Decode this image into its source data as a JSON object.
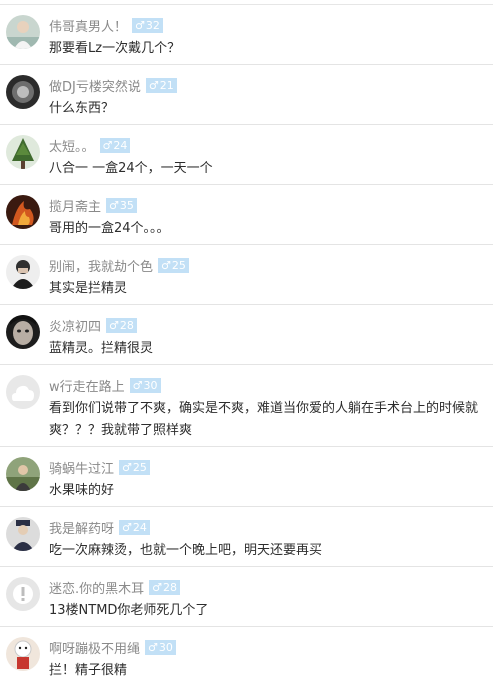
{
  "comments": [
    {
      "username": "伟哥真男人！",
      "gender_symbol": "♂",
      "age": "32",
      "text": "那要看Lz一次戴几个？",
      "avatar_icon": "person-photo-icon"
    },
    {
      "username": "做DJ亏楼突然说",
      "gender_symbol": "♂",
      "age": "21",
      "text": "什么东西？",
      "avatar_icon": "person-photo-icon"
    },
    {
      "username": "太短。。",
      "gender_symbol": "♂",
      "age": "24",
      "text": "八合一 一盒24个，一天一个",
      "avatar_icon": "tree-photo-icon"
    },
    {
      "username": "揽月斋主",
      "gender_symbol": "♂",
      "age": "35",
      "text": "哥用的一盒24个。。。",
      "avatar_icon": "fire-photo-icon"
    },
    {
      "username": "别闹，我就劫个色",
      "gender_symbol": "♂",
      "age": "25",
      "text": "其实是拦精灵",
      "avatar_icon": "person-photo-icon"
    },
    {
      "username": "炎凉初四",
      "gender_symbol": "♂",
      "age": "28",
      "text": "蓝精灵。拦精很灵",
      "avatar_icon": "face-photo-icon"
    },
    {
      "username": "w行走在路上",
      "gender_symbol": "♂",
      "age": "30",
      "text": "看到你们说带了不爽，确实是不爽，难道当你爱的人躺在手术台上的时候就爽？？？我就带了照样爽",
      "avatar_icon": "default-avatar-icon"
    },
    {
      "username": "骑蜗牛过江",
      "gender_symbol": "♂",
      "age": "25",
      "text": "水果味的好",
      "avatar_icon": "person-photo-icon"
    },
    {
      "username": "我是解药呀",
      "gender_symbol": "♂",
      "age": "24",
      "text": "吃一次麻辣烫，也就一个晚上吧，明天还要再买",
      "avatar_icon": "person-photo-icon"
    },
    {
      "username": "迷恋.你的黑木耳",
      "gender_symbol": "♂",
      "age": "28",
      "text": "13楼NTMD你老师死几个了",
      "avatar_icon": "warning-avatar-icon"
    },
    {
      "username": "啊呀蹦极不用绳",
      "gender_symbol": "♂",
      "age": "30",
      "text": "拦！精子很精",
      "avatar_icon": "figure-photo-icon"
    }
  ],
  "colors": {
    "username": "#8a8a8a",
    "badge_bg": "#c2e0f6",
    "badge_text": "#ffffff",
    "text": "#2d2d2d",
    "divider": "#e4e4e4"
  }
}
